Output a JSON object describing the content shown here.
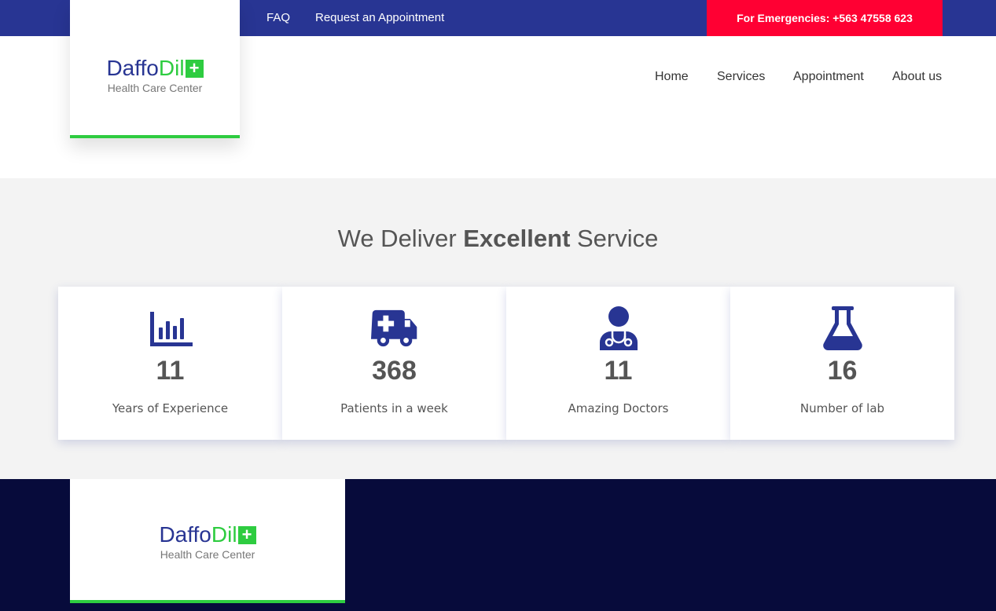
{
  "topbar": {
    "faq": "FAQ",
    "request_appointment": "Request an Appointment",
    "emergency": "For Emergencies: +563 47558 623"
  },
  "brand": {
    "name_part1": "Daffo",
    "name_part2": "Dil",
    "plus": "+",
    "tagline": "Health Care Center"
  },
  "nav": {
    "home": "Home",
    "services": "Services",
    "appointment": "Appointment",
    "about": "About us"
  },
  "services": {
    "title_pre": "We Deliver ",
    "title_bold": "Excellent",
    "title_post": " Service",
    "stats": [
      {
        "icon": "bar-chart-icon",
        "value": "11",
        "label": "Years of Experience"
      },
      {
        "icon": "ambulance-icon",
        "value": "368",
        "label": "Patients in a week"
      },
      {
        "icon": "doctor-icon",
        "value": "11",
        "label": "Amazing Doctors"
      },
      {
        "icon": "flask-icon",
        "value": "16",
        "label": "Number of lab"
      }
    ]
  },
  "colors": {
    "primary": "#283593",
    "accent_green": "#2ecc40",
    "emergency_red": "#ff0033",
    "footer_bg": "#070b3b",
    "section_bg": "#f3f3f3"
  }
}
